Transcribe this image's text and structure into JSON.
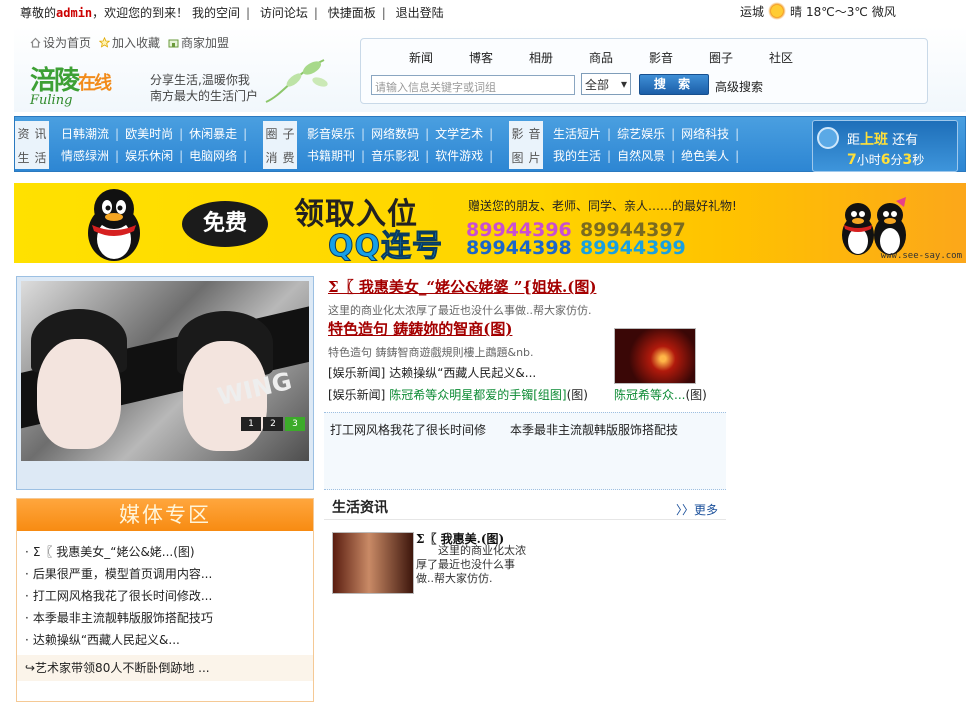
{
  "topbar": {
    "greet_prefix": "尊敬的",
    "username": "admin",
    "greet_suffix": "，欢迎您的到来！",
    "links": [
      "我的空间",
      "访问论坛",
      "快捷面板",
      "退出登陆"
    ],
    "sep": "|"
  },
  "weather": {
    "city": "运城",
    "icon": "sun-icon",
    "condition": "晴",
    "temp": "18℃～3℃",
    "wind": "微风"
  },
  "header": {
    "quick_links": [
      "设为首页",
      "加入收藏",
      "商家加盟"
    ],
    "logo_cn_1": "涪陵",
    "logo_cn_2": "在线",
    "logo_en": "Fuling",
    "slogan_1": "分享生活,温暖你我",
    "slogan_2": "南方最大的生活门户"
  },
  "search": {
    "tabs": [
      "新闻",
      "博客",
      "相册",
      "商品",
      "影音",
      "圈子",
      "社区"
    ],
    "placeholder": "请输入信息关键字或词组",
    "scope": "全部",
    "button": "搜 索",
    "advanced": "高级搜索"
  },
  "nav": {
    "groups": [
      {
        "label": [
          "资",
          "讯",
          "生",
          "活"
        ],
        "row1": [
          "日韩潮流",
          "欧美时尚",
          "休闲暴走"
        ],
        "row2": [
          "情感绿洲",
          "娱乐休闲",
          "电脑网络"
        ]
      },
      {
        "label": [
          "圈",
          "子",
          "消",
          "费"
        ],
        "row1": [
          "影音娱乐",
          "网络数码",
          "文学艺术"
        ],
        "row2": [
          "书籍期刊",
          "音乐影视",
          "软件游戏"
        ]
      },
      {
        "label": [
          "影",
          "音",
          "图",
          "片"
        ],
        "row1": [
          "生活短片",
          "综艺娱乐",
          "网络科技"
        ],
        "row2": [
          "我的生活",
          "自然风景",
          "绝色美人"
        ]
      }
    ]
  },
  "countdown": {
    "prefix": "距",
    "target": "上班",
    "suffix": "还有",
    "hours": "7",
    "hours_unit": "小时",
    "minutes": "6",
    "minutes_unit": "分",
    "seconds": "3",
    "seconds_unit": "秒"
  },
  "banner": {
    "free": "免费",
    "title_1": "领取入位",
    "title_2": "QQ连号",
    "gift": "赠送您的朋友、老师、同学、亲人……的最好礼物!",
    "numbers": [
      "89944396",
      "89944397",
      "89944398",
      "89944399"
    ],
    "url": "www.see-say.com"
  },
  "slideshow": {
    "caption": "WING",
    "pages": [
      "1",
      "2",
      "3"
    ],
    "active_page": "3"
  },
  "media": {
    "heading": "媒体专区",
    "items": [
      "Σ〖 我惠美女_“姥公&姥...(图)",
      "后果很严重，模型首页调用内容...",
      "打工网风格我花了很长时间修改...",
      "本季最非主流靓韩版服饰搭配技巧",
      "达赖操纵“西藏人民起义&..."
    ],
    "footer": "↪艺术家带领80人不断卧倒跡地 ..."
  },
  "headlines": {
    "title_1": "Σ〖 我惠美女_“姥公&姥婆 ”{姐妹.(图)",
    "desc_1": "这里的商业化太浓厚了最近也没什么事做..帮大家仿仿.",
    "title_2": "特色造句 鋳鋳妳的智商(图)",
    "desc_2": "特色造句  鋳鋳智商遊戲規則樓上鵡題&nb.",
    "line_3_cat": "[娱乐新闻]",
    "line_3_text": "达赖操纵“西藏人民起义&...",
    "line_4_cat": "[娱乐新闻]",
    "line_4_text": "陈冠希等众明星都爱的手镯[组图]",
    "line_4_tag": "(图)",
    "thumb_caption": "陈冠希等众...",
    "thumb_tag": "(图)",
    "row_left": "打工网风格我花了很长时间修",
    "row_right": "本季最非主流靓韩版服饰搭配技"
  },
  "life": {
    "heading": "生活资讯",
    "more": "〉〉更多",
    "item_title": "Σ〖 我惠美.(图)",
    "item_desc": "这里的商业化太浓厚了最近也没什么事做..帮大家仿仿."
  }
}
